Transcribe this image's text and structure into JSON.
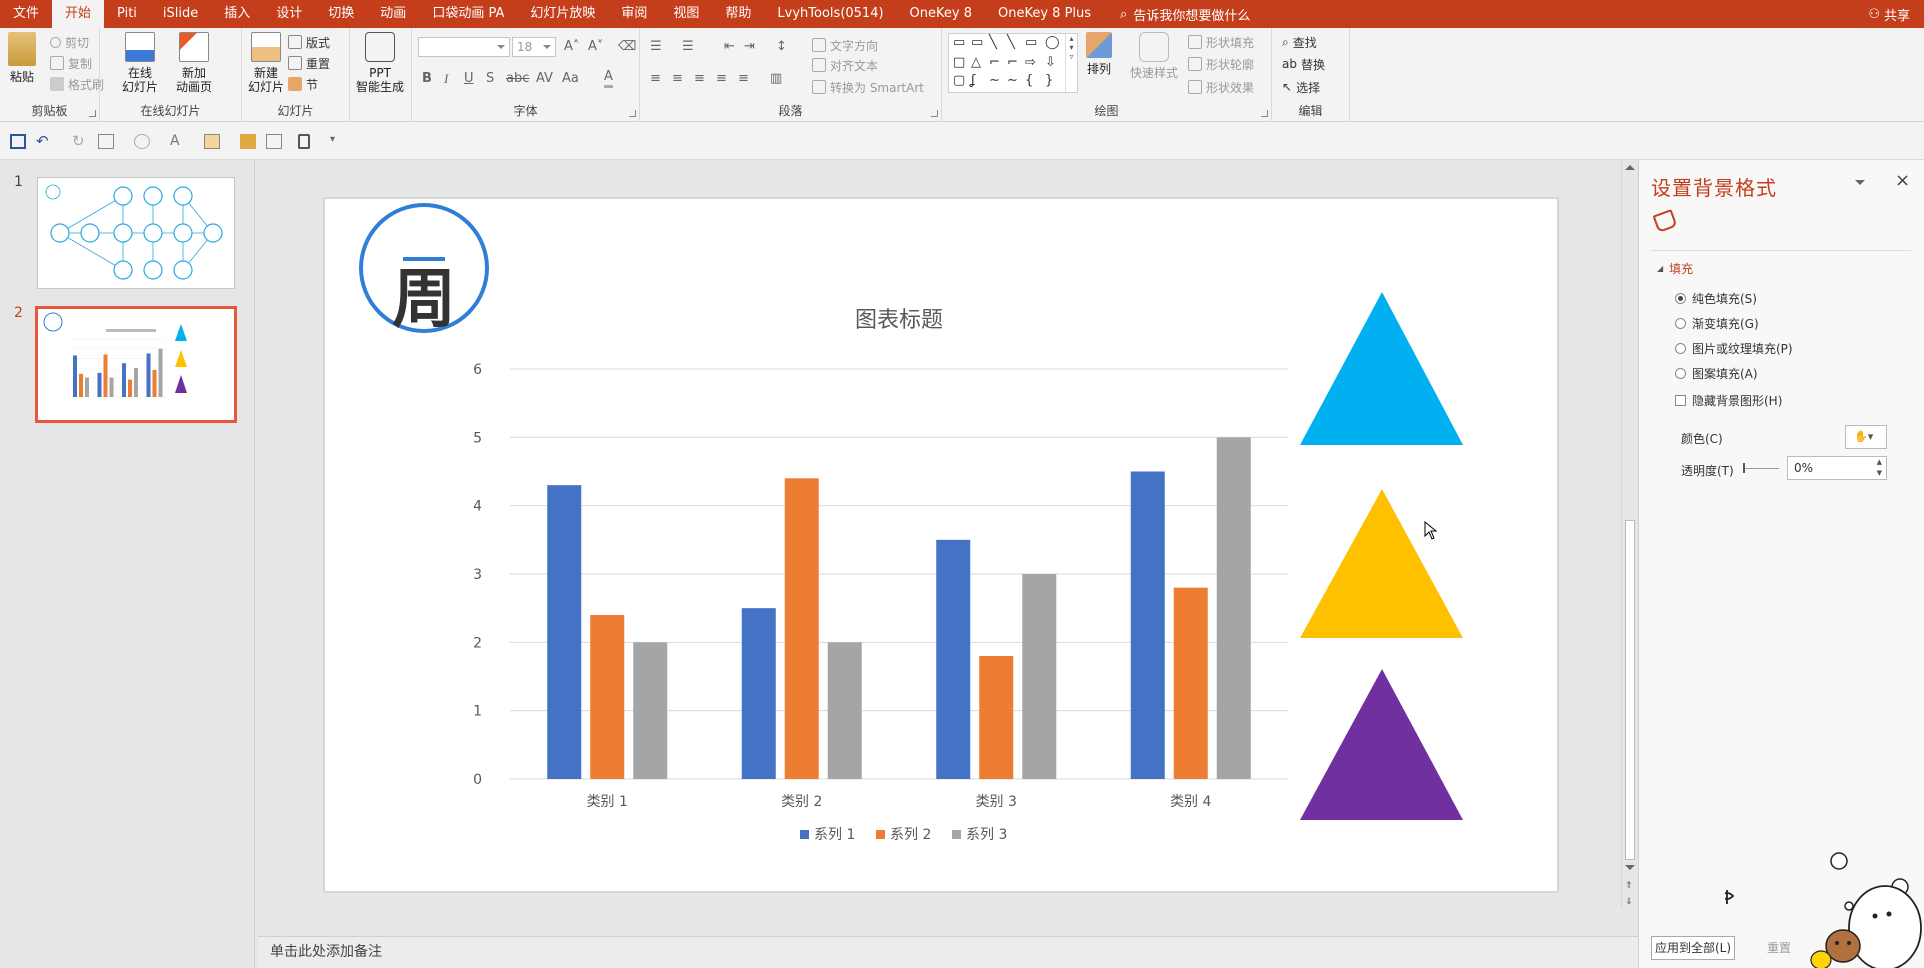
{
  "ribbon_tabs": [
    "文件",
    "开始",
    "Piti",
    "iSlide",
    "插入",
    "设计",
    "切换",
    "动画",
    "口袋动画 PA",
    "幻灯片放映",
    "审阅",
    "视图",
    "帮助",
    "LvyhTools(0514)",
    "OneKey 8",
    "OneKey 8 Plus"
  ],
  "active_tab": "开始",
  "tell_me": "告诉我你想要做什么",
  "share": "共享",
  "clipboard": {
    "label": "剪贴板",
    "paste": "粘贴",
    "cut": "剪切",
    "copy": "复制",
    "format_painter": "格式刷"
  },
  "online_slides": {
    "label": "在线幻灯片",
    "online_l1": "在线",
    "online_l2": "幻灯片",
    "new_anim_l1": "新加",
    "new_anim_l2": "动画页"
  },
  "slides_group": {
    "label": "幻灯片",
    "new_l1": "新建",
    "new_l2": "幻灯片",
    "layout": "版式",
    "reset": "重置",
    "section": "节"
  },
  "ppt_ai": {
    "l1": "PPT",
    "l2": "智能生成"
  },
  "font_group": {
    "label": "字体",
    "font_size": "18"
  },
  "paragraph": {
    "label": "段落",
    "text_direction": "文字方向",
    "align_text": "对齐文本",
    "smartart": "转换为 SmartArt"
  },
  "drawing": {
    "label": "绘图",
    "arrange": "排列",
    "quick_styles": "快速样式",
    "shape_fill": "形状填充",
    "shape_outline": "形状轮廓",
    "shape_effects": "形状效果"
  },
  "editing": {
    "label": "编辑",
    "find": "查找",
    "replace": "替换",
    "select": "选择"
  },
  "thumbnails": [
    {
      "num": "1"
    },
    {
      "num": "2"
    }
  ],
  "chart_data": {
    "type": "bar",
    "title": "图表标题",
    "categories": [
      "类别 1",
      "类别 2",
      "类别 3",
      "类别 4"
    ],
    "series": [
      {
        "name": "系列 1",
        "color": "#4472c4",
        "values": [
          4.3,
          2.5,
          3.5,
          4.5
        ]
      },
      {
        "name": "系列 2",
        "color": "#ed7d31",
        "values": [
          2.4,
          4.4,
          1.8,
          2.8
        ]
      },
      {
        "name": "系列 3",
        "color": "#a5a5a5",
        "values": [
          2.0,
          2.0,
          3.0,
          5.0
        ]
      }
    ],
    "ylim": [
      0,
      6
    ],
    "yticks": [
      "0",
      "1",
      "2",
      "3",
      "4",
      "5",
      "6"
    ],
    "grid": true,
    "legend": "bottom"
  },
  "logo_char": "周",
  "triangle_colors": [
    "#00b0f0",
    "#ffc000",
    "#7030a0"
  ],
  "notes_placeholder": "单击此处添加备注",
  "pane": {
    "title": "设置背景格式",
    "section": "填充",
    "options": [
      "纯色填充(S)",
      "渐变填充(G)",
      "图片或纹理填充(P)",
      "图案填充(A)"
    ],
    "hide_bg": "隐藏背景图形(H)",
    "color_label": "颜色(C)",
    "transparency_label": "透明度(T)",
    "transparency_value": "0%",
    "apply_all": "应用到全部(L)",
    "reset": "重置"
  }
}
